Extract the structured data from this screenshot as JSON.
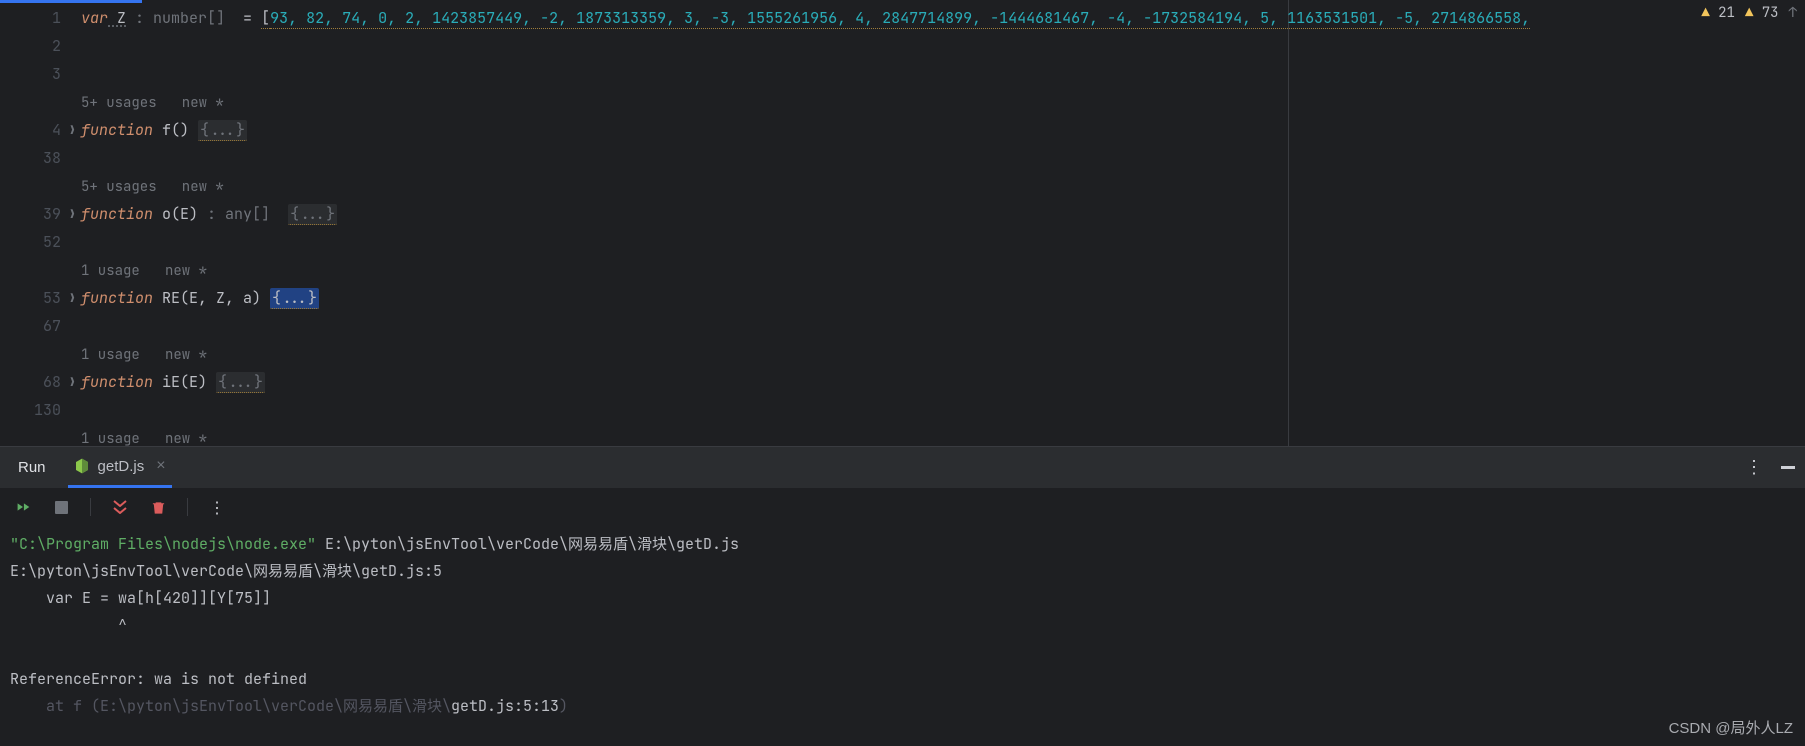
{
  "editor": {
    "gutter": [
      "1",
      "2",
      "3",
      "",
      "4",
      "38",
      "",
      "39",
      "52",
      "",
      "53",
      "67",
      "",
      "68",
      "130",
      ""
    ],
    "fold_rows": [
      4,
      7,
      10,
      13
    ],
    "line1": {
      "kw": "var",
      "name": " Z",
      "type": " : number[]  ",
      "eq": "= ",
      "open": "[",
      "arr": "93, 82, 74, 0, 2, 1423857449, -2, 1873313359, 3, -3, 1555261956, 4, 2847714899, -1444681467, -4, -1732584194, 5, 1163531501, -5, 2714866558,"
    },
    "hint_a": "5+ usages   new *",
    "func_f": {
      "kw": "function",
      "name": " f",
      "sig": "() ",
      "body": "{...}"
    },
    "hint_b": "5+ usages   new *",
    "func_o": {
      "kw": "function",
      "name": " o",
      "sig": "(E) ",
      "ret": ": any[]  ",
      "body": "{...}"
    },
    "hint_c": "1 usage   new *",
    "func_RE": {
      "kw": "function",
      "name": " RE",
      "sig": "(E, Z, a) ",
      "body": "{...}"
    },
    "hint_d": "1 usage   new *",
    "func_iE": {
      "kw": "function",
      "name": " iE",
      "sig": "(E) ",
      "body": "{...}"
    },
    "hint_e": "1 usage   new *"
  },
  "status": {
    "warn1_count": "21",
    "warn2_count": "73"
  },
  "run": {
    "title": "Run",
    "tab_label": "getD.js"
  },
  "console": {
    "l1_a": "\"C:\\Program Files\\nodejs\\node.exe\"",
    "l1_b": " E:\\pyton\\jsEnvTool\\verCode\\网易易盾\\滑块\\getD.js",
    "l2": "E:\\pyton\\jsEnvTool\\verCode\\网易易盾\\滑块\\getD.js:5",
    "l3": "    var E = wa[h[420]][Y[75]]",
    "l4": "            ^",
    "l5": "",
    "l6": "ReferenceError: wa is not defined",
    "l7_dim": "    at f (E:\\pyton\\jsEnvTool\\verCode\\网易易盾\\滑块\\",
    "l7_b": "getD.js:5:13",
    "l7_c": ")"
  },
  "watermark": "CSDN @局外人LZ"
}
